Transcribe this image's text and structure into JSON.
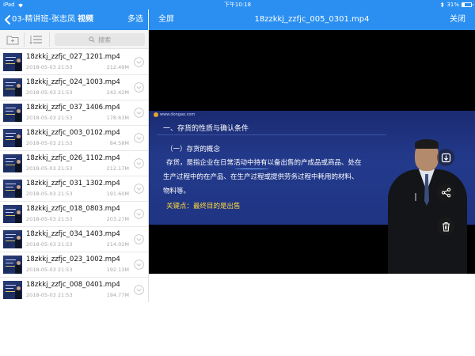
{
  "status_bar": {
    "device": "iPad",
    "time": "下午10:18",
    "battery_percent": "31%",
    "battery_level": 0.31
  },
  "left_header": {
    "back_icon": "chevron-left-icon",
    "title": "03-精讲班-张志凤",
    "subtitle": "视频",
    "multi_select_label": "多选"
  },
  "right_header": {
    "fullscreen_label": "全屏",
    "video_title": "18zzkkj_zzfjc_005_0301.mp4",
    "close_label": "关闭"
  },
  "toolbar": {
    "folder_icon": "folder-icon",
    "sort_icon": "sort-list-icon",
    "search_placeholder": "搜索"
  },
  "files": [
    {
      "name": "18zkkj_zzfjc_027_1201.mp4",
      "date": "2018-05-03 21:53",
      "size": "212.49M"
    },
    {
      "name": "18zkkj_zzfjc_024_1003.mp4",
      "date": "2018-05-03 21:53",
      "size": "242.42M"
    },
    {
      "name": "18zkkj_zzfjc_037_1406.mp4",
      "date": "2018-05-03 21:53",
      "size": "178.63M"
    },
    {
      "name": "18zkkj_zzfjc_003_0102.mp4",
      "date": "2018-05-03 21:53",
      "size": "84.58M"
    },
    {
      "name": "18zkkj_zzfjc_026_1102.mp4",
      "date": "2018-05-03 21:53",
      "size": "212.17M"
    },
    {
      "name": "18zkkj_zzfjc_031_1302.mp4",
      "date": "2018-05-03 21:53",
      "size": "191.60M"
    },
    {
      "name": "18zkkj_zzfjc_018_0803.mp4",
      "date": "2018-05-03 21:53",
      "size": "203.27M"
    },
    {
      "name": "18zkkj_zzfjc_034_1403.mp4",
      "date": "2018-05-03 21:53",
      "size": "214.02M"
    },
    {
      "name": "18zkkj_zzfjc_023_1002.mp4",
      "date": "2018-05-03 21:53",
      "size": "192.13M"
    },
    {
      "name": "18zkkj_zzfjc_008_0401.mp4",
      "date": "2018-05-03 21:53",
      "size": "194.77M"
    }
  ],
  "slide": {
    "logo_text": "www.dongao.com",
    "heading": "一、存货的性质与确认条件",
    "subheading": "（一）存货的概念",
    "para_line1": "存货，是指企业在日常活动中持有以备出售的产成品或商品、处在",
    "para_line2": "生产过程中的在产品、在生产过程或提供劳务过程中耗用的材料、",
    "para_line3": "物料等。",
    "key_point": "关键点：最终目的是出售"
  },
  "side_actions": {
    "download_icon": "download-icon",
    "share_icon": "share-icon",
    "delete_icon": "trash-icon"
  },
  "colors": {
    "header_blue": "#2a8ff0",
    "slide_blue": "#233a8c",
    "key_yellow": "#ffd93c"
  }
}
